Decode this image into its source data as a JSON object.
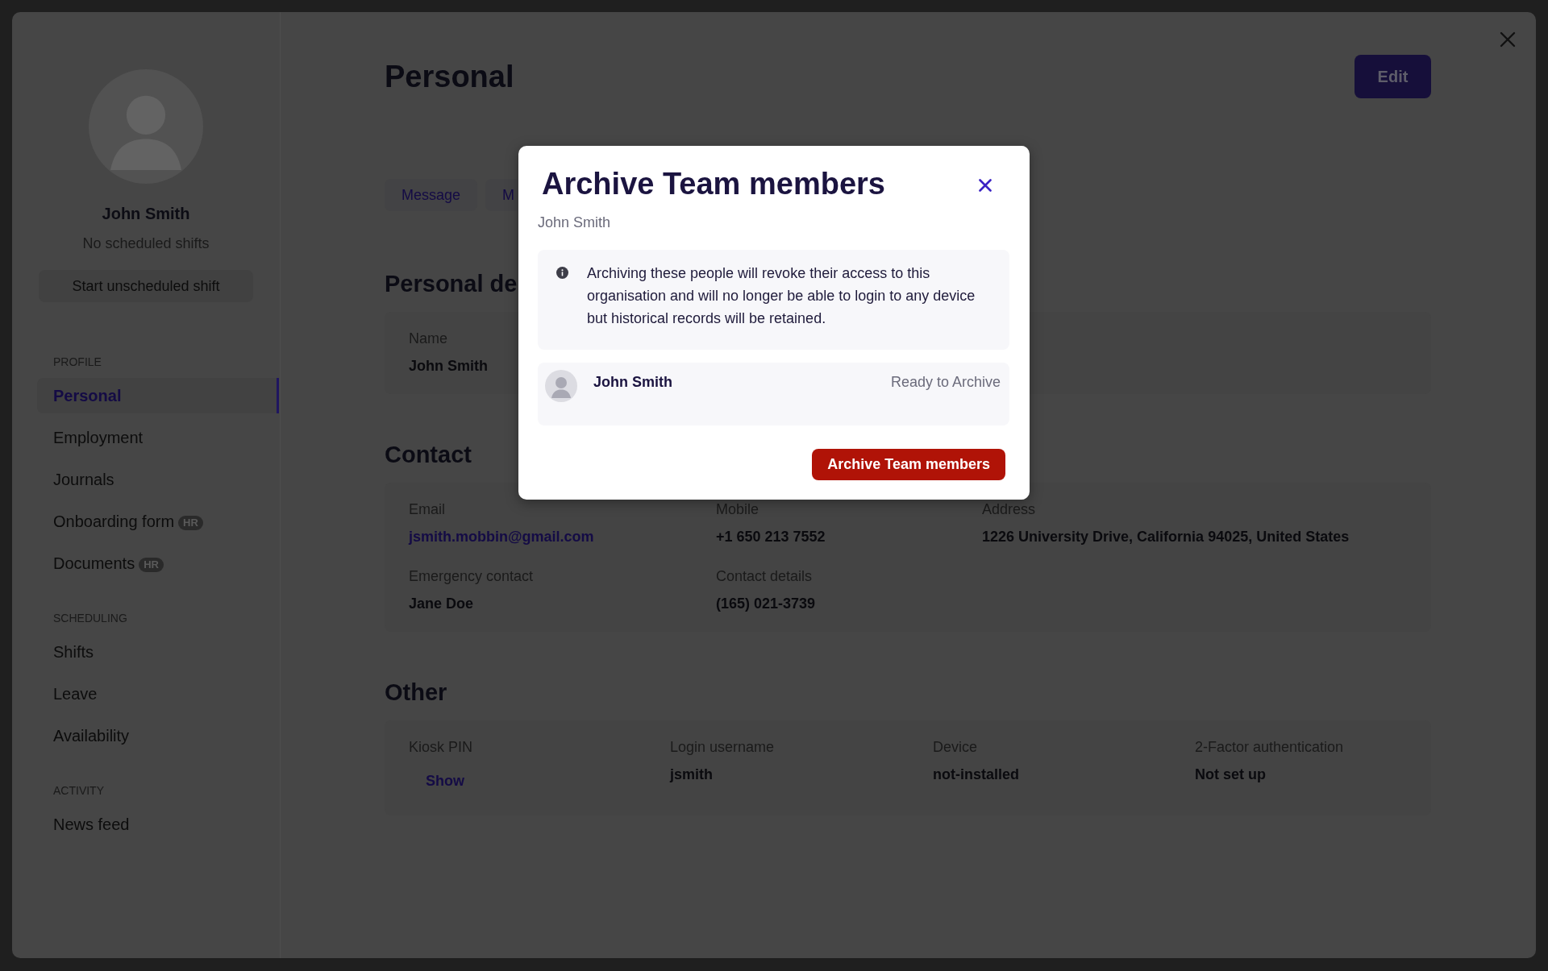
{
  "sidebar": {
    "profile": {
      "name": "John Smith",
      "status": "No scheduled shifts",
      "action": "Start unscheduled shift"
    },
    "sections": [
      {
        "heading": "PROFILE",
        "items": [
          {
            "label": "Personal",
            "selected": true
          },
          {
            "label": "Employment",
            "selected": false
          },
          {
            "label": "Journals",
            "selected": false
          },
          {
            "label": "Onboarding form",
            "badge": "HR",
            "selected": false
          },
          {
            "label": "Documents",
            "badge": "HR",
            "selected": false
          }
        ]
      },
      {
        "heading": "SCHEDULING",
        "items": [
          {
            "label": "Shifts",
            "selected": false
          },
          {
            "label": "Leave",
            "selected": false
          },
          {
            "label": "Availability",
            "selected": false
          }
        ]
      },
      {
        "heading": "ACTIVITY",
        "items": [
          {
            "label": "News feed",
            "selected": false
          }
        ]
      }
    ]
  },
  "page": {
    "title": "Personal",
    "edit_button": "Edit",
    "actions": [
      "Message",
      "M"
    ],
    "sections": [
      {
        "heading": "Personal de",
        "rows": [
          [
            {
              "label": "Name",
              "value": "John Smith",
              "kind": "text"
            }
          ]
        ]
      },
      {
        "heading": "Contact",
        "rows": [
          [
            {
              "label": "Email",
              "value": "jsmith.mobbin@gmail.com",
              "kind": "link"
            },
            {
              "label": "Mobile",
              "value": "+1 650 213 7552",
              "kind": "text"
            },
            {
              "label": "Address",
              "value": "1226 University Drive, California 94025, United States",
              "kind": "text"
            }
          ],
          [
            {
              "label": "Emergency contact",
              "value": "Jane Doe",
              "kind": "text"
            },
            {
              "label": "Contact details",
              "value": "(165) 021-3739",
              "kind": "text"
            }
          ]
        ]
      },
      {
        "heading": "Other",
        "rows": [
          [
            {
              "label": "Kiosk PIN",
              "value": "Show",
              "kind": "button"
            },
            {
              "label": "Login username",
              "value": "jsmith",
              "kind": "text"
            },
            {
              "label": "Device",
              "value": "not-installed",
              "kind": "text"
            },
            {
              "label": "2-Factor authentication",
              "value": "Not set up",
              "kind": "text"
            }
          ]
        ]
      }
    ]
  },
  "dialog": {
    "title": "Archive Team members",
    "subtitle": "John Smith",
    "notice": "Archiving these people will revoke their access to this organisation and will no longer be able to login to any device but historical records will be retained.",
    "members": [
      {
        "name": "John Smith",
        "status": "Ready to Archive"
      }
    ],
    "confirm_button": "Archive Team members"
  }
}
